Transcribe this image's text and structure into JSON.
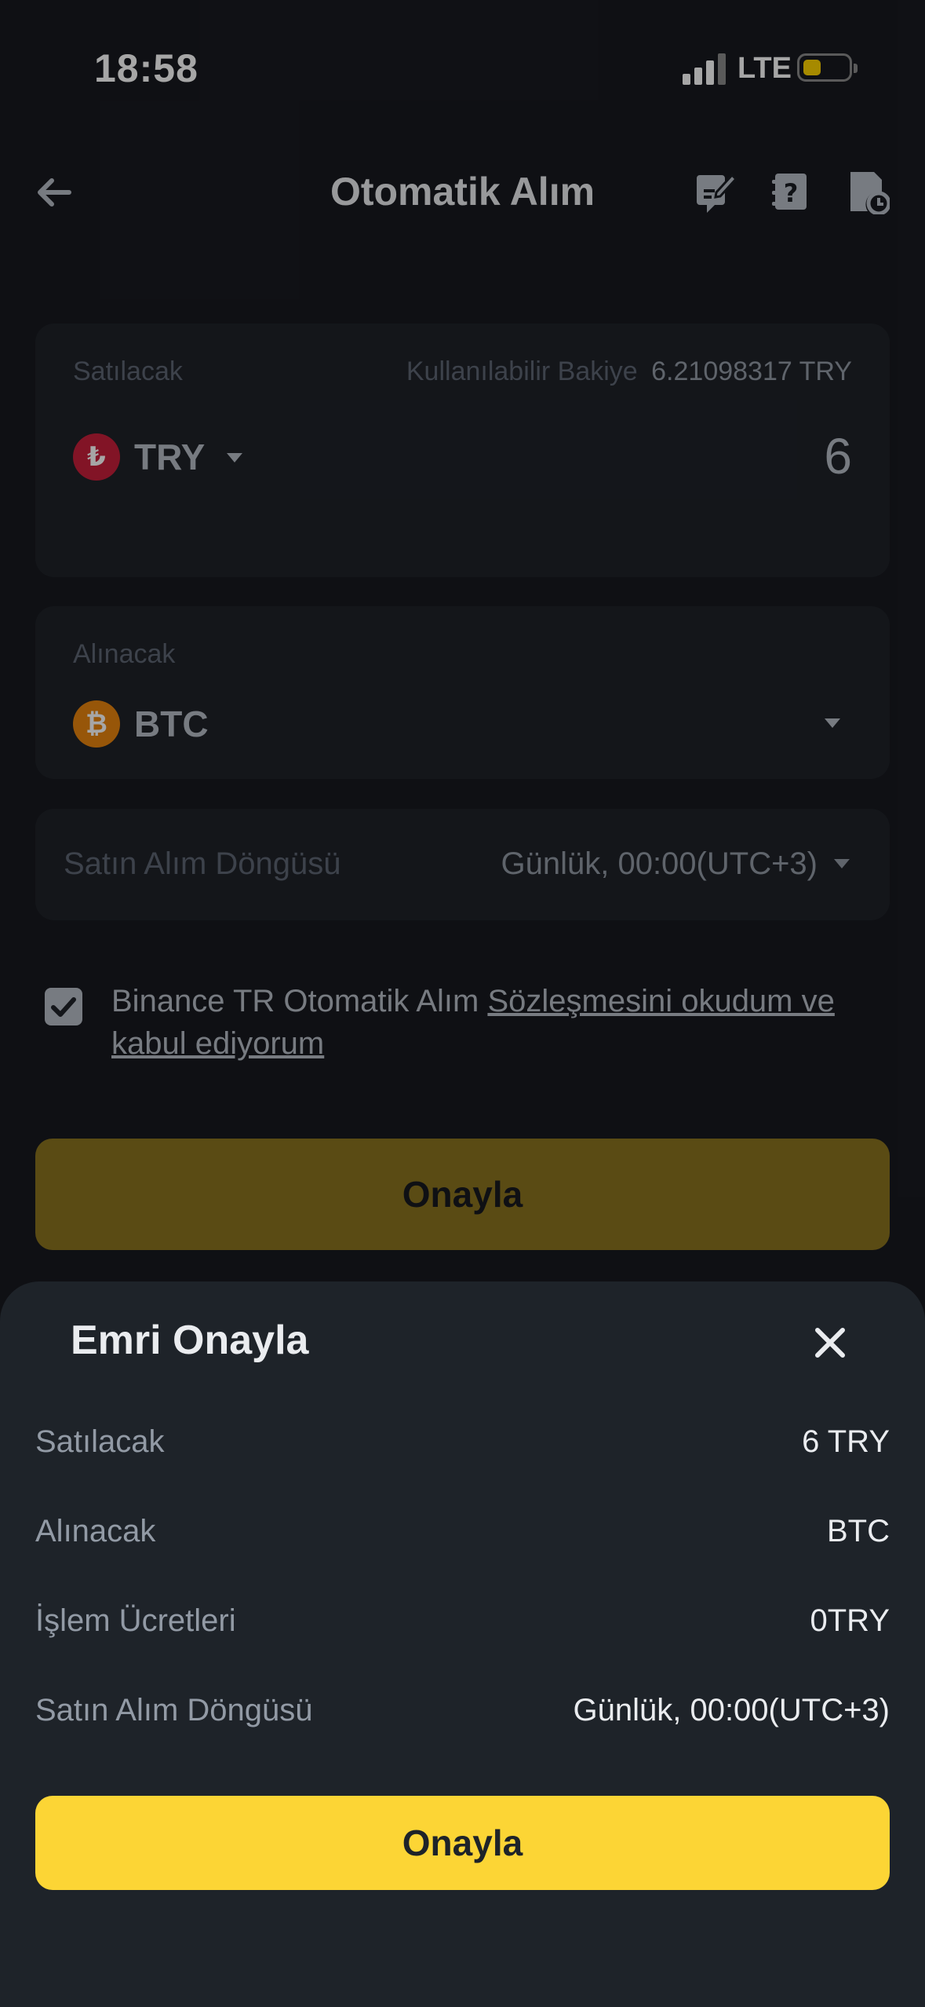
{
  "status_bar": {
    "time": "18:58",
    "network": "LTE"
  },
  "header": {
    "title": "Otomatik Alım"
  },
  "sell_card": {
    "label": "Satılacak",
    "balance_label": "Kullanılabilir Bakiye",
    "balance_value": "6.21098317 TRY",
    "coin_symbol": "₺",
    "coin": "TRY",
    "amount": "6"
  },
  "buy_card": {
    "label": "Alınacak",
    "coin_symbol": "₿",
    "coin": "BTC"
  },
  "cycle_card": {
    "label": "Satın Alım Döngüsü",
    "value": "Günlük, 00:00(UTC+3)"
  },
  "agreement": {
    "checked": true,
    "text": "Binance TR Otomatik Alım ",
    "link_line1": "Sözleşmesini okudum ve",
    "link_line2": "kabul ediyorum"
  },
  "confirm_button": {
    "label": "Onayla"
  },
  "sheet": {
    "title": "Emri Onayla",
    "rows": [
      {
        "label": "Satılacak",
        "value": "6 TRY"
      },
      {
        "label": "Alınacak",
        "value": "BTC"
      },
      {
        "label": "İşlem Ücretleri",
        "value": "0TRY"
      },
      {
        "label": "Satın Alım Döngüsü",
        "value": "Günlük, 00:00(UTC+3)"
      }
    ],
    "confirm_label": "Onayla"
  },
  "colors": {
    "background": "#181a20",
    "card": "#1f2229",
    "sheet": "#1e2329",
    "accent": "#fcd535",
    "accent_dimmed": "#8b731f",
    "try_coin": "#c8203b",
    "btc_coin": "#e8850f"
  }
}
